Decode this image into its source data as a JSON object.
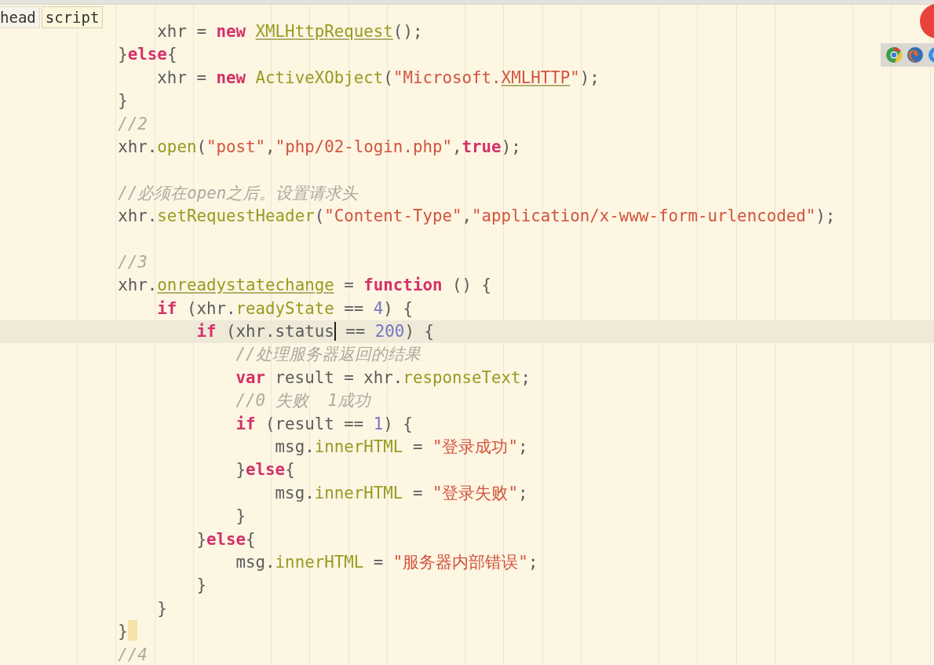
{
  "breadcrumb": [
    {
      "label": "head",
      "selected": false
    },
    {
      "label": "script",
      "selected": true
    }
  ],
  "lines": [
    {
      "current": false,
      "tokens": [
        {
          "kind": "plain",
          "text": "                xhr = "
        },
        {
          "kind": "keyword",
          "text": "new "
        },
        {
          "kind": "method",
          "text": "XMLHttpRequest",
          "underline": true
        },
        {
          "kind": "plain",
          "text": "();"
        }
      ]
    },
    {
      "current": false,
      "tokens": [
        {
          "kind": "plain",
          "text": "            }"
        },
        {
          "kind": "keyword",
          "text": "else"
        },
        {
          "kind": "plain",
          "text": "{"
        }
      ]
    },
    {
      "current": false,
      "tokens": [
        {
          "kind": "plain",
          "text": "                xhr = "
        },
        {
          "kind": "keyword",
          "text": "new "
        },
        {
          "kind": "method",
          "text": "ActiveXObject"
        },
        {
          "kind": "plain",
          "text": "("
        },
        {
          "kind": "string",
          "text": "\"Microsoft."
        },
        {
          "kind": "string",
          "text": "XMLHTTP",
          "underline": true
        },
        {
          "kind": "string",
          "text": "\""
        },
        {
          "kind": "plain",
          "text": ");"
        }
      ]
    },
    {
      "current": false,
      "tokens": [
        {
          "kind": "plain",
          "text": "            }"
        }
      ]
    },
    {
      "current": false,
      "tokens": [
        {
          "kind": "comment",
          "text": "            //2"
        }
      ]
    },
    {
      "current": false,
      "tokens": [
        {
          "kind": "plain",
          "text": "            xhr."
        },
        {
          "kind": "method",
          "text": "open"
        },
        {
          "kind": "plain",
          "text": "("
        },
        {
          "kind": "string",
          "text": "\"post\""
        },
        {
          "kind": "plain",
          "text": ","
        },
        {
          "kind": "string",
          "text": "\"php/02-login.php\""
        },
        {
          "kind": "plain",
          "text": ","
        },
        {
          "kind": "keyword",
          "text": "true"
        },
        {
          "kind": "plain",
          "text": ");"
        }
      ]
    },
    {
      "current": false
    },
    {
      "current": false,
      "tokens": [
        {
          "kind": "comment",
          "text": "            //必须在open之后。设置请求头"
        }
      ]
    },
    {
      "current": false,
      "tokens": [
        {
          "kind": "plain",
          "text": "            xhr."
        },
        {
          "kind": "method",
          "text": "setRequestHeader"
        },
        {
          "kind": "plain",
          "text": "("
        },
        {
          "kind": "string",
          "text": "\"Content-Type\""
        },
        {
          "kind": "plain",
          "text": ","
        },
        {
          "kind": "string",
          "text": "\"application/x-www-form-urlencoded\""
        },
        {
          "kind": "plain",
          "text": ");"
        }
      ]
    },
    {
      "current": false
    },
    {
      "current": false,
      "tokens": [
        {
          "kind": "comment",
          "text": "            //3"
        }
      ]
    },
    {
      "current": false,
      "tokens": [
        {
          "kind": "plain",
          "text": "            xhr."
        },
        {
          "kind": "method",
          "text": "onreadystatechange",
          "underline": true
        },
        {
          "kind": "plain",
          "text": " = "
        },
        {
          "kind": "keyword",
          "text": "function"
        },
        {
          "kind": "plain",
          "text": " () {"
        }
      ]
    },
    {
      "current": false,
      "tokens": [
        {
          "kind": "keyword",
          "text": "                if"
        },
        {
          "kind": "plain",
          "text": " (xhr."
        },
        {
          "kind": "method",
          "text": "readyState"
        },
        {
          "kind": "plain",
          "text": " == "
        },
        {
          "kind": "number",
          "text": "4"
        },
        {
          "kind": "plain",
          "text": ") {"
        }
      ]
    },
    {
      "current": true,
      "tokens": [
        {
          "kind": "keyword",
          "text": "                    if"
        },
        {
          "kind": "plain",
          "text": " (xhr.status",
          "caret_after": true
        },
        {
          "kind": "plain",
          "text": " == "
        },
        {
          "kind": "number",
          "text": "200"
        },
        {
          "kind": "plain",
          "text": ") {"
        }
      ]
    },
    {
      "current": false,
      "tokens": [
        {
          "kind": "comment",
          "text": "                        //处理服务器返回的结果"
        }
      ]
    },
    {
      "current": false,
      "tokens": [
        {
          "kind": "keyword",
          "text": "                        var"
        },
        {
          "kind": "plain",
          "text": " result = xhr."
        },
        {
          "kind": "method",
          "text": "responseText"
        },
        {
          "kind": "plain",
          "text": ";"
        }
      ]
    },
    {
      "current": false,
      "tokens": [
        {
          "kind": "comment",
          "text": "                        //0 失败  1成功"
        }
      ]
    },
    {
      "current": false,
      "tokens": [
        {
          "kind": "keyword",
          "text": "                        if"
        },
        {
          "kind": "plain",
          "text": " (result == "
        },
        {
          "kind": "number",
          "text": "1"
        },
        {
          "kind": "plain",
          "text": ") {"
        }
      ]
    },
    {
      "current": false,
      "tokens": [
        {
          "kind": "plain",
          "text": "                            msg."
        },
        {
          "kind": "method",
          "text": "innerHTML"
        },
        {
          "kind": "plain",
          "text": " = "
        },
        {
          "kind": "string",
          "text": "\"登录成功\""
        },
        {
          "kind": "plain",
          "text": ";"
        }
      ]
    },
    {
      "current": false,
      "tokens": [
        {
          "kind": "plain",
          "text": "                        }"
        },
        {
          "kind": "keyword",
          "text": "else"
        },
        {
          "kind": "plain",
          "text": "{"
        }
      ]
    },
    {
      "current": false,
      "tokens": [
        {
          "kind": "plain",
          "text": "                            msg."
        },
        {
          "kind": "method",
          "text": "innerHTML"
        },
        {
          "kind": "plain",
          "text": " = "
        },
        {
          "kind": "string",
          "text": "\"登录失败\""
        },
        {
          "kind": "plain",
          "text": ";"
        }
      ]
    },
    {
      "current": false,
      "tokens": [
        {
          "kind": "plain",
          "text": "                        }"
        }
      ]
    },
    {
      "current": false,
      "tokens": [
        {
          "kind": "plain",
          "text": "                    }"
        },
        {
          "kind": "keyword",
          "text": "else"
        },
        {
          "kind": "plain",
          "text": "{"
        }
      ]
    },
    {
      "current": false,
      "tokens": [
        {
          "kind": "plain",
          "text": "                        msg."
        },
        {
          "kind": "method",
          "text": "innerHTML"
        },
        {
          "kind": "plain",
          "text": " = "
        },
        {
          "kind": "string",
          "text": "\"服务器内部错误\""
        },
        {
          "kind": "plain",
          "text": ";"
        }
      ]
    },
    {
      "current": false,
      "tokens": [
        {
          "kind": "plain",
          "text": "                    }"
        }
      ]
    },
    {
      "current": false,
      "tokens": [
        {
          "kind": "plain",
          "text": "                }"
        }
      ]
    },
    {
      "current": false,
      "bracket_highlight": true,
      "tokens": [
        {
          "kind": "plain",
          "text": "            }"
        }
      ]
    },
    {
      "current": false,
      "tokens": [
        {
          "kind": "comment",
          "text": "            //4"
        }
      ]
    }
  ]
}
